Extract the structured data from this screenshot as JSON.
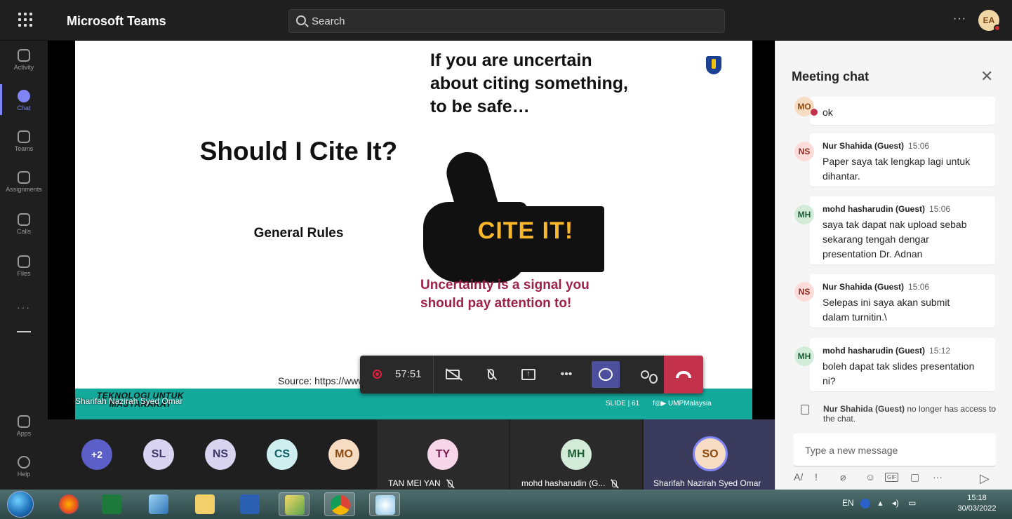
{
  "topbar": {
    "app_title": "Microsoft Teams",
    "search_placeholder": "Search",
    "more_label": "···",
    "avatar_initials": "EA"
  },
  "rail": {
    "items": [
      {
        "label": "Activity",
        "icon": "bell-icon"
      },
      {
        "label": "Chat",
        "icon": "chat-icon"
      },
      {
        "label": "Teams",
        "icon": "teams-icon"
      },
      {
        "label": "Assignments",
        "icon": "assignments-icon"
      },
      {
        "label": "Calls",
        "icon": "phone-icon"
      },
      {
        "label": "Files",
        "icon": "file-icon"
      },
      {
        "label": "Apps",
        "icon": "apps-icon"
      },
      {
        "label": "Help",
        "icon": "help-icon"
      }
    ],
    "more_label": "···"
  },
  "slide": {
    "question": "Should I Cite It?",
    "subtitle": "General Rules",
    "right_title": "If you are uncertain about citing something, to be safe…",
    "cite_label": "CITE IT!",
    "warning": "Uncertainty is a signal you should pay attention to!",
    "source": "Source: https://www",
    "footer_brand": "TEKNOLOGI UNTUK MASYARAKAT",
    "slide_number": "SLIDE | 61",
    "social": "f◎▶ UMPMalaysia"
  },
  "presenter_label": "Sharifah Nazirah Syed Omar",
  "controls": {
    "timer": "57:51",
    "more_label": "•••"
  },
  "participants": {
    "overflow": "+2",
    "avatars": [
      {
        "initials": "SL",
        "bg": "#d9d4f0",
        "fg": "#3f3a6b"
      },
      {
        "initials": "NS",
        "bg": "#d9d4f0",
        "fg": "#3f3a6b"
      },
      {
        "initials": "CS",
        "bg": "#cfeef0",
        "fg": "#0d5d63"
      },
      {
        "initials": "MO",
        "bg": "#f6dcc3",
        "fg": "#8a4a10"
      }
    ],
    "tiles": [
      {
        "initials": "TY",
        "name": "TAN MEI YAN",
        "bg": "#f7d6ea",
        "fg": "#7b1f55"
      },
      {
        "initials": "MH",
        "name": "mohd hasharudin (G...",
        "bg": "#d2ecd9",
        "fg": "#1e5c33"
      },
      {
        "initials": "SO",
        "name": "Sharifah Nazirah Syed Omar",
        "bg": "#f6dcc3",
        "fg": "#8a4a10"
      }
    ]
  },
  "chat": {
    "title": "Meeting chat",
    "messages": [
      {
        "initials": "MO",
        "author": "",
        "time": "",
        "text": "ok",
        "bg": "#f6dcc3",
        "fg": "#8a4a10"
      },
      {
        "initials": "NS",
        "author": "Nur Shahida (Guest)",
        "time": "15:06",
        "text": "Paper saya tak lengkap lagi untuk dihantar.",
        "bg": "#fbdcd9",
        "fg": "#8a2a1f"
      },
      {
        "initials": "MH",
        "author": "mohd hasharudin (Guest)",
        "time": "15:06",
        "text": "saya tak dapat nak upload sebab sekarang tengah dengar presentation Dr. Adnan",
        "bg": "#d2ecd9",
        "fg": "#1e5c33"
      },
      {
        "initials": "NS",
        "author": "Nur Shahida (Guest)",
        "time": "15:06",
        "text": "Selepas ini saya akan submit dalam turnitin.\\",
        "bg": "#fbdcd9",
        "fg": "#8a2a1f"
      },
      {
        "initials": "MH",
        "author": "mohd hasharudin (Guest)",
        "time": "15:12",
        "text": "boleh dapat tak slides presentation ni?",
        "bg": "#d2ecd9",
        "fg": "#1e5c33"
      }
    ],
    "system_name": "Nur Shahida (Guest)",
    "system_text": " no longer has access to the chat.",
    "compose_placeholder": "Type a new message",
    "gif_label": "GIF",
    "more_label": "···"
  },
  "taskbar": {
    "language": "EN",
    "time": "15:18",
    "date": "30/03/2022"
  }
}
